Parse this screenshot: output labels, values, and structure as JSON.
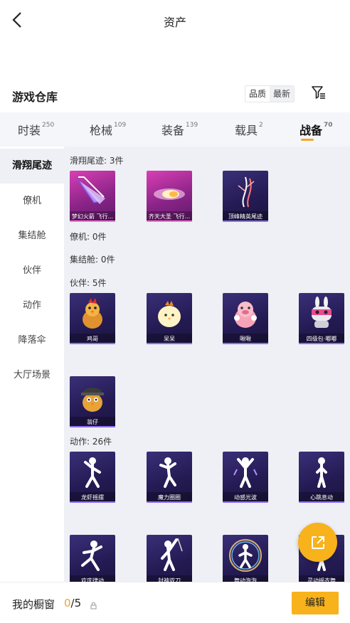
{
  "header": {
    "title": "资产"
  },
  "warehouse": {
    "title": "游戏仓库",
    "sort_options": [
      "品质",
      "最新"
    ],
    "sort_selected": "最新"
  },
  "tabs": [
    {
      "label": "时装",
      "count": "250"
    },
    {
      "label": "枪械",
      "count": "109"
    },
    {
      "label": "装备",
      "count": "139"
    },
    {
      "label": "载具",
      "count": "2"
    },
    {
      "label": "战备",
      "count": "70"
    }
  ],
  "active_tab": "战备",
  "sidebar": {
    "items": [
      "滑翔尾迹",
      "僚机",
      "集结舱",
      "伙伴",
      "动作",
      "降落伞",
      "大厅场景"
    ],
    "active": "滑翔尾迹"
  },
  "sections": [
    {
      "label": "滑翔尾迹: 3件",
      "items": [
        "梦幻火箭 飞行...",
        "齐天大圣 飞行...",
        "顶峰精英尾迹"
      ]
    },
    {
      "label": "僚机: 0件",
      "items": []
    },
    {
      "label": "集结舱: 0件",
      "items": []
    },
    {
      "label": "伙伴: 5件",
      "items": [
        "鸡哥",
        "呆呆",
        "啾啾",
        "四级包·嘟嘟",
        "翁仔"
      ]
    },
    {
      "label": "动作: 26件",
      "items": [
        "龙虾摇摆",
        "魔力圈圈",
        "动感光波",
        "心跳息动",
        "欢庆律动",
        "封神双刀",
        "舞动泡泡",
        "灵动摇衣舞"
      ]
    }
  ],
  "bottom": {
    "label": "我的橱窗",
    "current": "0",
    "total": "/5",
    "edit_label": "编辑"
  },
  "colors": {
    "accent": "#f5a623",
    "card_purple": "#2a1f5e",
    "card_pink": "#c53aa8"
  }
}
